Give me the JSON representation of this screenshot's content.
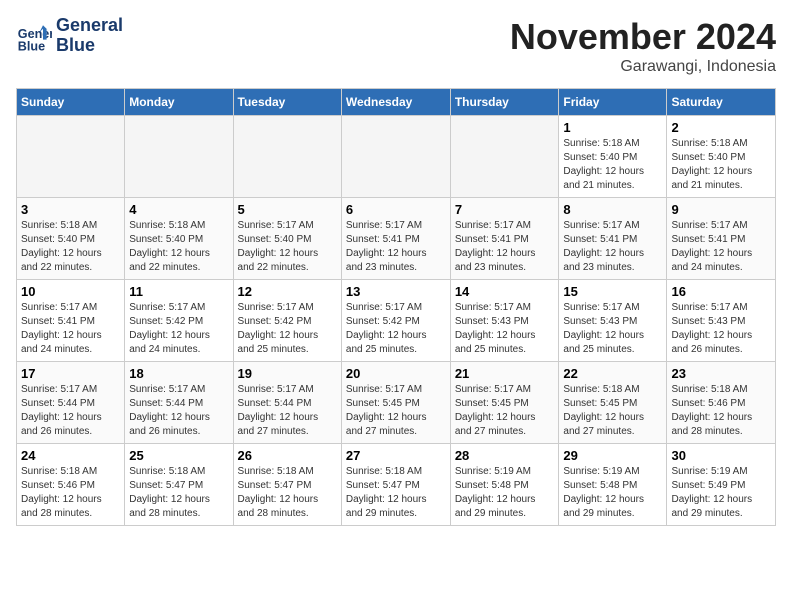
{
  "logo": {
    "line1": "General",
    "line2": "Blue"
  },
  "title": "November 2024",
  "location": "Garawangi, Indonesia",
  "days_header": [
    "Sunday",
    "Monday",
    "Tuesday",
    "Wednesday",
    "Thursday",
    "Friday",
    "Saturday"
  ],
  "weeks": [
    [
      {
        "num": "",
        "info": "",
        "empty": true
      },
      {
        "num": "",
        "info": "",
        "empty": true
      },
      {
        "num": "",
        "info": "",
        "empty": true
      },
      {
        "num": "",
        "info": "",
        "empty": true
      },
      {
        "num": "",
        "info": "",
        "empty": true
      },
      {
        "num": "1",
        "info": "Sunrise: 5:18 AM\nSunset: 5:40 PM\nDaylight: 12 hours\nand 21 minutes.",
        "empty": false
      },
      {
        "num": "2",
        "info": "Sunrise: 5:18 AM\nSunset: 5:40 PM\nDaylight: 12 hours\nand 21 minutes.",
        "empty": false
      }
    ],
    [
      {
        "num": "3",
        "info": "Sunrise: 5:18 AM\nSunset: 5:40 PM\nDaylight: 12 hours\nand 22 minutes.",
        "empty": false
      },
      {
        "num": "4",
        "info": "Sunrise: 5:18 AM\nSunset: 5:40 PM\nDaylight: 12 hours\nand 22 minutes.",
        "empty": false
      },
      {
        "num": "5",
        "info": "Sunrise: 5:17 AM\nSunset: 5:40 PM\nDaylight: 12 hours\nand 22 minutes.",
        "empty": false
      },
      {
        "num": "6",
        "info": "Sunrise: 5:17 AM\nSunset: 5:41 PM\nDaylight: 12 hours\nand 23 minutes.",
        "empty": false
      },
      {
        "num": "7",
        "info": "Sunrise: 5:17 AM\nSunset: 5:41 PM\nDaylight: 12 hours\nand 23 minutes.",
        "empty": false
      },
      {
        "num": "8",
        "info": "Sunrise: 5:17 AM\nSunset: 5:41 PM\nDaylight: 12 hours\nand 23 minutes.",
        "empty": false
      },
      {
        "num": "9",
        "info": "Sunrise: 5:17 AM\nSunset: 5:41 PM\nDaylight: 12 hours\nand 24 minutes.",
        "empty": false
      }
    ],
    [
      {
        "num": "10",
        "info": "Sunrise: 5:17 AM\nSunset: 5:41 PM\nDaylight: 12 hours\nand 24 minutes.",
        "empty": false
      },
      {
        "num": "11",
        "info": "Sunrise: 5:17 AM\nSunset: 5:42 PM\nDaylight: 12 hours\nand 24 minutes.",
        "empty": false
      },
      {
        "num": "12",
        "info": "Sunrise: 5:17 AM\nSunset: 5:42 PM\nDaylight: 12 hours\nand 25 minutes.",
        "empty": false
      },
      {
        "num": "13",
        "info": "Sunrise: 5:17 AM\nSunset: 5:42 PM\nDaylight: 12 hours\nand 25 minutes.",
        "empty": false
      },
      {
        "num": "14",
        "info": "Sunrise: 5:17 AM\nSunset: 5:43 PM\nDaylight: 12 hours\nand 25 minutes.",
        "empty": false
      },
      {
        "num": "15",
        "info": "Sunrise: 5:17 AM\nSunset: 5:43 PM\nDaylight: 12 hours\nand 25 minutes.",
        "empty": false
      },
      {
        "num": "16",
        "info": "Sunrise: 5:17 AM\nSunset: 5:43 PM\nDaylight: 12 hours\nand 26 minutes.",
        "empty": false
      }
    ],
    [
      {
        "num": "17",
        "info": "Sunrise: 5:17 AM\nSunset: 5:44 PM\nDaylight: 12 hours\nand 26 minutes.",
        "empty": false
      },
      {
        "num": "18",
        "info": "Sunrise: 5:17 AM\nSunset: 5:44 PM\nDaylight: 12 hours\nand 26 minutes.",
        "empty": false
      },
      {
        "num": "19",
        "info": "Sunrise: 5:17 AM\nSunset: 5:44 PM\nDaylight: 12 hours\nand 27 minutes.",
        "empty": false
      },
      {
        "num": "20",
        "info": "Sunrise: 5:17 AM\nSunset: 5:45 PM\nDaylight: 12 hours\nand 27 minutes.",
        "empty": false
      },
      {
        "num": "21",
        "info": "Sunrise: 5:17 AM\nSunset: 5:45 PM\nDaylight: 12 hours\nand 27 minutes.",
        "empty": false
      },
      {
        "num": "22",
        "info": "Sunrise: 5:18 AM\nSunset: 5:45 PM\nDaylight: 12 hours\nand 27 minutes.",
        "empty": false
      },
      {
        "num": "23",
        "info": "Sunrise: 5:18 AM\nSunset: 5:46 PM\nDaylight: 12 hours\nand 28 minutes.",
        "empty": false
      }
    ],
    [
      {
        "num": "24",
        "info": "Sunrise: 5:18 AM\nSunset: 5:46 PM\nDaylight: 12 hours\nand 28 minutes.",
        "empty": false
      },
      {
        "num": "25",
        "info": "Sunrise: 5:18 AM\nSunset: 5:47 PM\nDaylight: 12 hours\nand 28 minutes.",
        "empty": false
      },
      {
        "num": "26",
        "info": "Sunrise: 5:18 AM\nSunset: 5:47 PM\nDaylight: 12 hours\nand 28 minutes.",
        "empty": false
      },
      {
        "num": "27",
        "info": "Sunrise: 5:18 AM\nSunset: 5:47 PM\nDaylight: 12 hours\nand 29 minutes.",
        "empty": false
      },
      {
        "num": "28",
        "info": "Sunrise: 5:19 AM\nSunset: 5:48 PM\nDaylight: 12 hours\nand 29 minutes.",
        "empty": false
      },
      {
        "num": "29",
        "info": "Sunrise: 5:19 AM\nSunset: 5:48 PM\nDaylight: 12 hours\nand 29 minutes.",
        "empty": false
      },
      {
        "num": "30",
        "info": "Sunrise: 5:19 AM\nSunset: 5:49 PM\nDaylight: 12 hours\nand 29 minutes.",
        "empty": false
      }
    ]
  ]
}
